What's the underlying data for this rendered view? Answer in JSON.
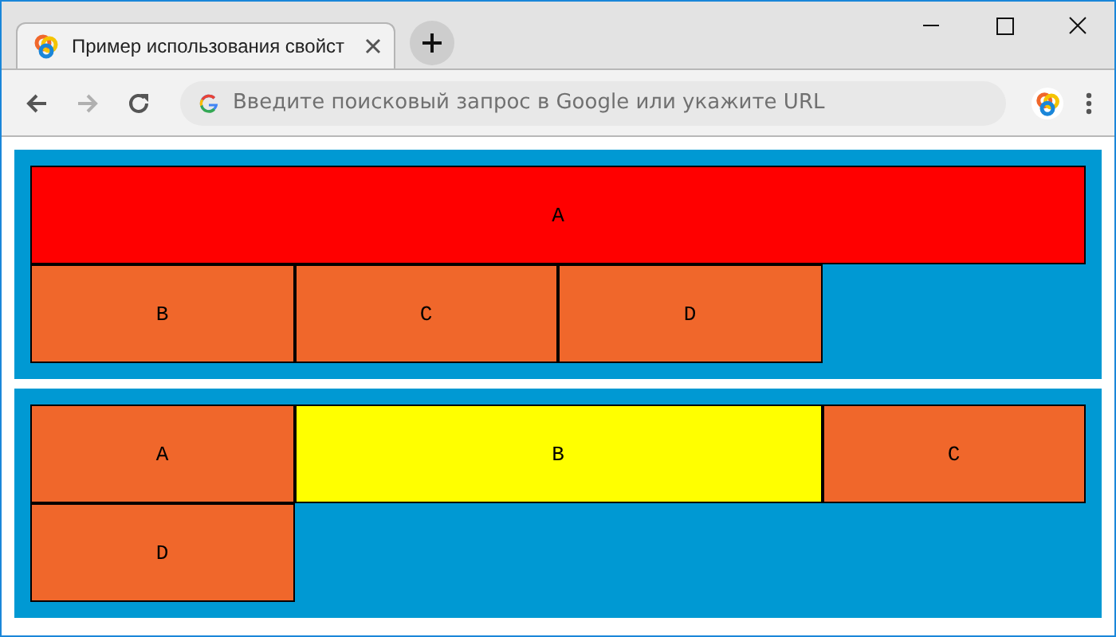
{
  "window": {
    "tab_title": "Пример использования свойст",
    "address_placeholder": "Введите поисковый запрос в Google или укажите URL"
  },
  "navigation": [
    {
      "kind": "back",
      "disabled": false
    },
    {
      "kind": "forward",
      "disabled": true
    },
    {
      "kind": "reload",
      "disabled": false
    }
  ],
  "containers": [
    {
      "items": [
        {
          "label": "A",
          "color": "#ff0000",
          "kind": "full"
        },
        {
          "label": "B",
          "color": "#f0672b",
          "kind": "single"
        },
        {
          "label": "C",
          "color": "#f0672b",
          "kind": "single"
        },
        {
          "label": "D",
          "color": "#f0672b",
          "kind": "single"
        }
      ]
    },
    {
      "items": [
        {
          "label": "A",
          "color": "#f0672b",
          "kind": "single"
        },
        {
          "label": "B",
          "color": "#ffff00",
          "kind": "double"
        },
        {
          "label": "C",
          "color": "#f0672b",
          "kind": "single"
        },
        {
          "label": "D",
          "color": "#f0672b",
          "kind": "single"
        }
      ]
    }
  ]
}
